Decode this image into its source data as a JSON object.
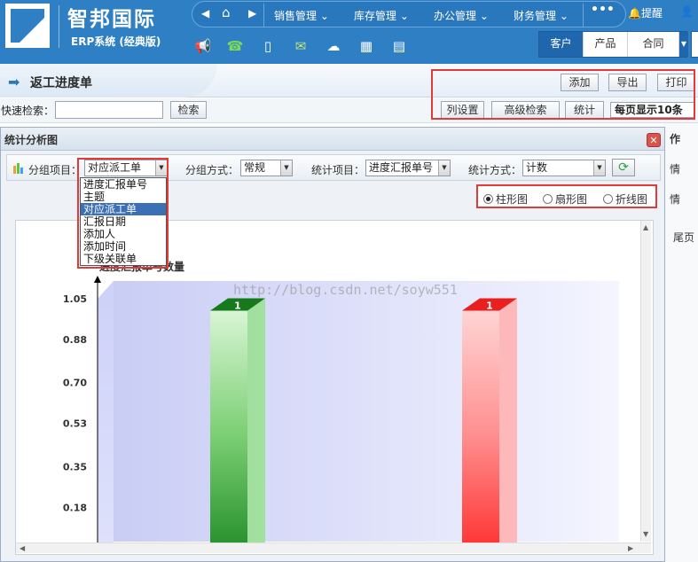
{
  "header": {
    "company_name": "智邦国际",
    "erp_label": "ERP系统 (经典版)",
    "nav_items": [
      "销售管理",
      "库存管理",
      "办公管理",
      "财务管理"
    ],
    "nav_more": "•••",
    "remind_label": "提醒",
    "quick_icons": [
      "megaphone-icon",
      "phone-icon",
      "mobile-icon",
      "mail-icon",
      "wechat-icon",
      "grid-icon",
      "document-icon"
    ],
    "tabs": [
      "客户",
      "产品",
      "合同"
    ],
    "active_tab": "客户",
    "brand_color": "#2e7fc3"
  },
  "page": {
    "title": "返工进度单",
    "buttons": {
      "add": "添加",
      "export": "导出",
      "print": "打印"
    },
    "search_label": "快速检索：",
    "search_value": "",
    "search_button": "检索",
    "column_settings": "列设置",
    "advanced_search": "高级检索",
    "statistics": "统计",
    "per_page": "每页显示10条",
    "bg_text": {
      "col_header": "作",
      "row1": "情",
      "row2": "情",
      "last_page": "尾页"
    }
  },
  "dialog": {
    "title": "统计分析图",
    "close": "✕",
    "group_item_label": "分组项目：",
    "group_item_value": "对应派工单",
    "group_method_label": "分组方式：",
    "group_method_value": "常规",
    "stat_item_label": "统计项目：",
    "stat_item_value": "进度汇报单号",
    "stat_method_label": "统计方式：",
    "stat_method_value": "计数",
    "dropdown_options": [
      "进度汇报单号",
      "主题",
      "对应派工单",
      "汇报日期",
      "添加人",
      "添加时间",
      "下级关联单"
    ],
    "dropdown_selected": "对应派工单",
    "chart_types": [
      "柱形图",
      "扇形图",
      "折线图"
    ],
    "chart_type_selected": "柱形图",
    "chart_heading": "进度汇报单号数量",
    "watermark": "http://blog.csdn.net/soyw551"
  },
  "chart_data": {
    "type": "bar",
    "title": "进度汇报单号数量",
    "categories": [
      "",
      ""
    ],
    "values": [
      1,
      1
    ],
    "value_labels": [
      "1",
      "1"
    ],
    "ylim": [
      0,
      1.05
    ],
    "y_ticks": [
      "1.05",
      "0.88",
      "0.70",
      "0.53",
      "0.35",
      "0.18"
    ],
    "colors": [
      "#2f9e2f",
      "#ff3333"
    ]
  }
}
